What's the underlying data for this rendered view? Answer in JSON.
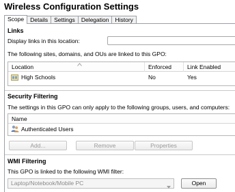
{
  "window": {
    "title": "Wireless Configuration Settings"
  },
  "tabs": [
    "Scope",
    "Details",
    "Settings",
    "Delegation",
    "History"
  ],
  "links": {
    "heading": "Links",
    "display_label": "Display links in this location:",
    "display_value": "",
    "linked_text": "The following sites, domains, and OUs are linked to this GPO:",
    "columns": [
      "Location",
      "Enforced",
      "Link Enabled"
    ],
    "rows": [
      {
        "location": "High Schools",
        "enforced": "No",
        "link_enabled": "Yes",
        "icon": "organizational-unit-icon"
      }
    ]
  },
  "security": {
    "heading": "Security Filtering",
    "description": "The settings in this GPO can only apply to the following groups, users, and computers:",
    "column": "Name",
    "rows": [
      {
        "name": "Authenticated Users",
        "icon": "users-group-icon"
      }
    ],
    "buttons": {
      "add": "Add...",
      "remove": "Remove",
      "properties": "Properties"
    }
  },
  "wmi": {
    "heading": "WMI Filtering",
    "description": "This GPO is linked to the following WMI filter:",
    "filter_value": "Laptop/Notebook/Mobile PC",
    "open_label": "Open"
  }
}
